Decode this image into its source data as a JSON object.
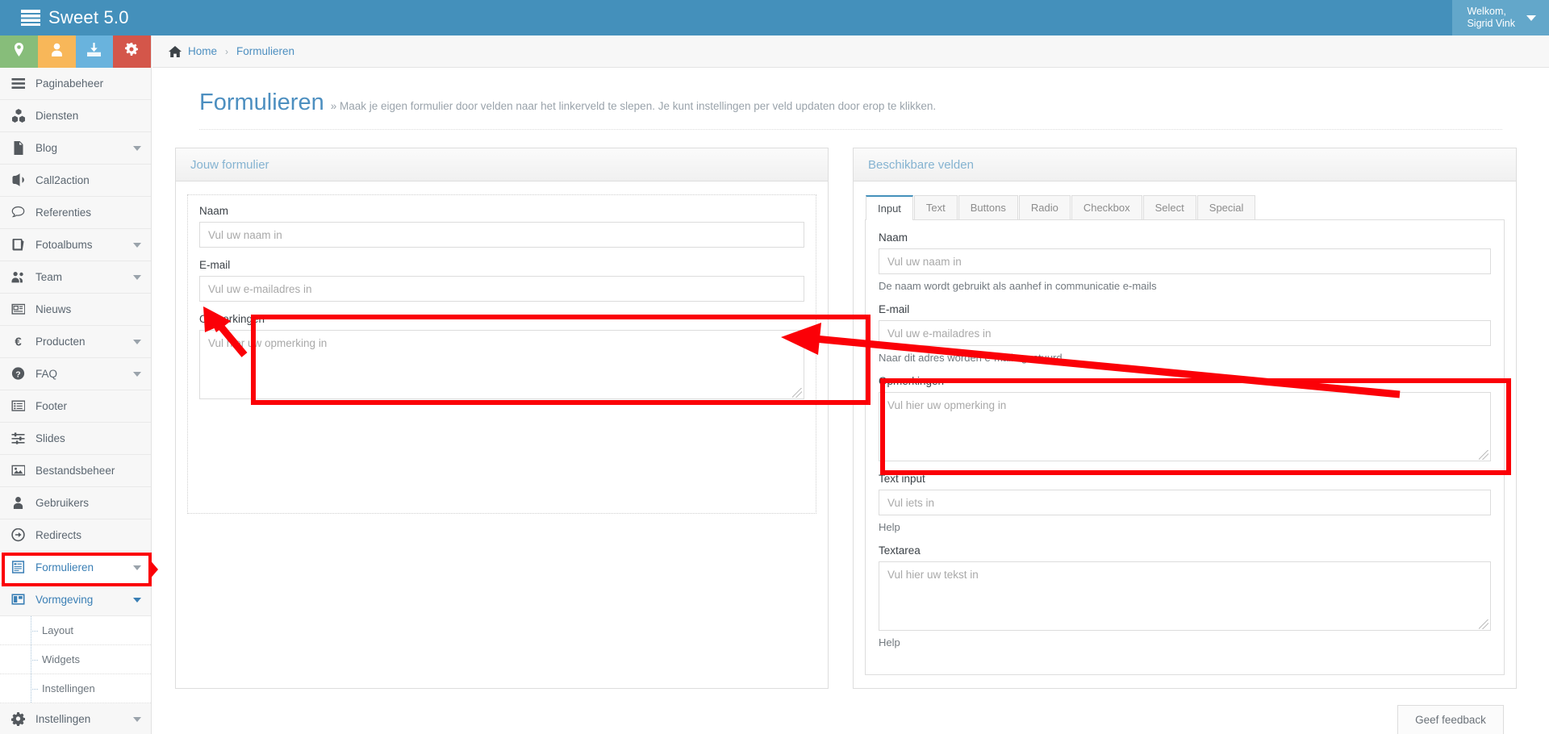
{
  "topbar": {
    "brand": "Sweet 5.0",
    "brand_icon": "server-stack-icon",
    "welcome_line1": "Welkom,",
    "welcome_line2": "Sigrid Vink"
  },
  "quick_buttons": [
    {
      "name": "location-button",
      "icon": "map-marker-icon",
      "color": "#87bd7a"
    },
    {
      "name": "user-button",
      "icon": "user-icon",
      "color": "#f8b759"
    },
    {
      "name": "download-button",
      "icon": "download-inbox-icon",
      "color": "#69b3dd"
    },
    {
      "name": "settings-button",
      "icon": "gears-icon",
      "color": "#d4564a"
    }
  ],
  "sidebar": {
    "items": [
      {
        "label": "Paginabeheer",
        "icon": "bars-icon",
        "caret": false,
        "active": false
      },
      {
        "label": "Diensten",
        "icon": "cubes-icon",
        "caret": false,
        "active": false
      },
      {
        "label": "Blog",
        "icon": "file-text-icon",
        "caret": true,
        "active": false
      },
      {
        "label": "Call2action",
        "icon": "bullhorn-icon",
        "caret": false,
        "active": false
      },
      {
        "label": "Referenties",
        "icon": "comment-icon",
        "caret": false,
        "active": false
      },
      {
        "label": "Fotoalbums",
        "icon": "book-icon",
        "caret": true,
        "active": false
      },
      {
        "label": "Team",
        "icon": "group-icon",
        "caret": true,
        "active": false
      },
      {
        "label": "Nieuws",
        "icon": "newspaper-icon",
        "caret": false,
        "active": false
      },
      {
        "label": "Producten",
        "icon": "euro-icon",
        "caret": true,
        "active": false
      },
      {
        "label": "FAQ",
        "icon": "question-icon",
        "caret": true,
        "active": false
      },
      {
        "label": "Footer",
        "icon": "list-alt-icon",
        "caret": false,
        "active": false
      },
      {
        "label": "Slides",
        "icon": "sliders-icon",
        "caret": false,
        "active": false
      },
      {
        "label": "Bestandsbeheer",
        "icon": "picture-icon",
        "caret": false,
        "active": false
      },
      {
        "label": "Gebruikers",
        "icon": "user-icon",
        "caret": false,
        "active": false
      },
      {
        "label": "Redirects",
        "icon": "arrow-circle-right-icon",
        "caret": false,
        "active": false
      },
      {
        "label": "Formulieren",
        "icon": "form-icon",
        "caret": true,
        "active": true
      },
      {
        "label": "Vormgeving",
        "icon": "columns-icon",
        "caret": true,
        "active": false
      }
    ],
    "subitems": [
      {
        "label": "Layout"
      },
      {
        "label": "Widgets"
      },
      {
        "label": "Instellingen"
      }
    ],
    "footer_item": {
      "label": "Instellingen",
      "icon": "gear-icon",
      "caret": true
    }
  },
  "breadcrumb": {
    "home_icon": "home-icon",
    "home": "Home",
    "separator": "›",
    "current": "Formulieren"
  },
  "page": {
    "title": "Formulieren",
    "subtitle": "» Maak je eigen formulier door velden naar het linkerveld te slepen. Je kunt instellingen per veld updaten door erop te klikken."
  },
  "left_panel": {
    "heading": "Jouw formulier",
    "fields": [
      {
        "label": "Naam",
        "placeholder": "Vul uw naam in",
        "type": "input"
      },
      {
        "label": "E-mail",
        "placeholder": "Vul uw e-mailadres in",
        "type": "input"
      },
      {
        "label": "Opmerkingen",
        "placeholder": "Vul hier uw opmerking in",
        "type": "textarea"
      }
    ]
  },
  "right_panel": {
    "heading": "Beschikbare velden",
    "tabs": [
      {
        "label": "Input",
        "active": true
      },
      {
        "label": "Text",
        "active": false
      },
      {
        "label": "Buttons",
        "active": false
      },
      {
        "label": "Radio",
        "active": false
      },
      {
        "label": "Checkbox",
        "active": false
      },
      {
        "label": "Select",
        "active": false
      },
      {
        "label": "Special",
        "active": false
      }
    ],
    "fields": [
      {
        "label": "Naam",
        "placeholder": "Vul uw naam in",
        "help": "De naam wordt gebruikt als aanhef in communicatie e-mails",
        "type": "input"
      },
      {
        "label": "E-mail",
        "placeholder": "Vul uw e-mailadres in",
        "help": "Naar dit adres worden e-mails gestuurd",
        "type": "input"
      },
      {
        "label": "Opmerkingen",
        "placeholder": "Vul hier uw opmerking in",
        "help": "",
        "type": "textarea"
      },
      {
        "label": "Text input",
        "placeholder": "Vul iets in",
        "help": "Help",
        "type": "input"
      },
      {
        "label": "Textarea",
        "placeholder": "Vul hier uw tekst in",
        "help": "Help",
        "type": "textarea"
      }
    ]
  },
  "feedback": {
    "label": "Geef feedback"
  },
  "annotation": {
    "color": "#fb0007"
  }
}
